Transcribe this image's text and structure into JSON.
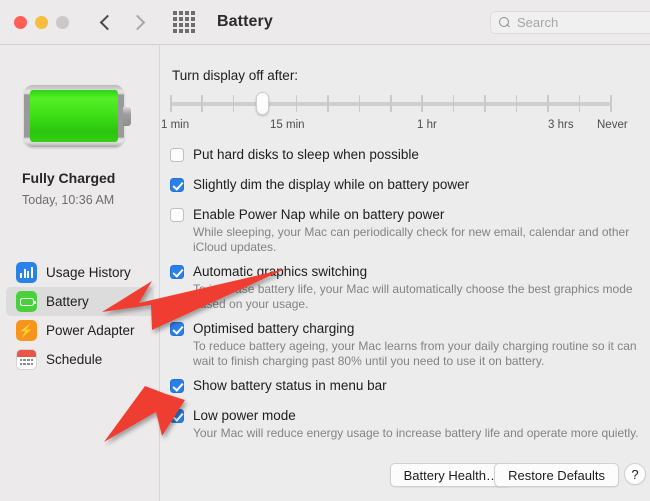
{
  "window": {
    "title": "Battery",
    "traffic_lights": [
      "close",
      "minimize",
      "maximize"
    ],
    "nav_back_icon": "chevron-left-icon",
    "nav_forward_icon": "chevron-right-icon",
    "grid_icon": "grid-apps-icon",
    "accent_color": "#2a7fe8"
  },
  "search": {
    "placeholder": "Search",
    "icon": "search-icon"
  },
  "sidebar": {
    "battery_icon": "battery-full-green-icon",
    "status": "Fully Charged",
    "timestamp": "Today, 10:36 AM",
    "items": [
      {
        "label": "Usage History",
        "icon": "usage-history-icon",
        "selected": false,
        "icon_color": "#2a82e8"
      },
      {
        "label": "Battery",
        "icon": "battery-icon",
        "selected": true,
        "icon_color": "#49d13d"
      },
      {
        "label": "Power Adapter",
        "icon": "power-adapter-icon",
        "selected": false,
        "icon_color": "#f7941d"
      },
      {
        "label": "Schedule",
        "icon": "schedule-icon",
        "selected": false,
        "icon_color": "#e8564a"
      }
    ]
  },
  "main": {
    "slider": {
      "label": "Turn display off after:",
      "marks": [
        "1 min",
        "15 min",
        "1 hr",
        "3 hrs",
        "Never"
      ],
      "mark_positions_pct": [
        0,
        33,
        69,
        95,
        100
      ],
      "tick_count": 15,
      "thumb_position_pct": 21
    },
    "options": [
      {
        "label": "Put hard disks to sleep when possible",
        "checked": false,
        "description": ""
      },
      {
        "label": "Slightly dim the display while on battery power",
        "checked": true,
        "description": ""
      },
      {
        "label": "Enable Power Nap while on battery power",
        "checked": false,
        "description": "While sleeping, your Mac can periodically check for new email, calendar and other iCloud updates."
      },
      {
        "label": "Automatic graphics switching",
        "checked": true,
        "description": "To increase battery life, your Mac will automatically choose the best graphics mode based on your usage."
      },
      {
        "label": "Optimised battery charging",
        "checked": true,
        "description": "To reduce battery ageing, your Mac learns from your daily charging routine so it can wait to finish charging past 80% until you need to use it on battery."
      },
      {
        "label": "Show battery status in menu bar",
        "checked": true,
        "description": ""
      },
      {
        "label": "Low power mode",
        "checked": true,
        "description": "Your Mac will reduce energy usage to increase battery life and operate more quietly."
      }
    ],
    "buttons": {
      "battery_health": "Battery Health…",
      "restore_defaults": "Restore Defaults",
      "help": "?"
    }
  },
  "annotations": {
    "arrow_color": "#f03c33",
    "arrows": [
      {
        "name": "arrow-to-battery-sidebar-item",
        "points_to": "Battery"
      },
      {
        "name": "arrow-to-low-power-mode",
        "points_to": "Low power mode"
      }
    ]
  }
}
